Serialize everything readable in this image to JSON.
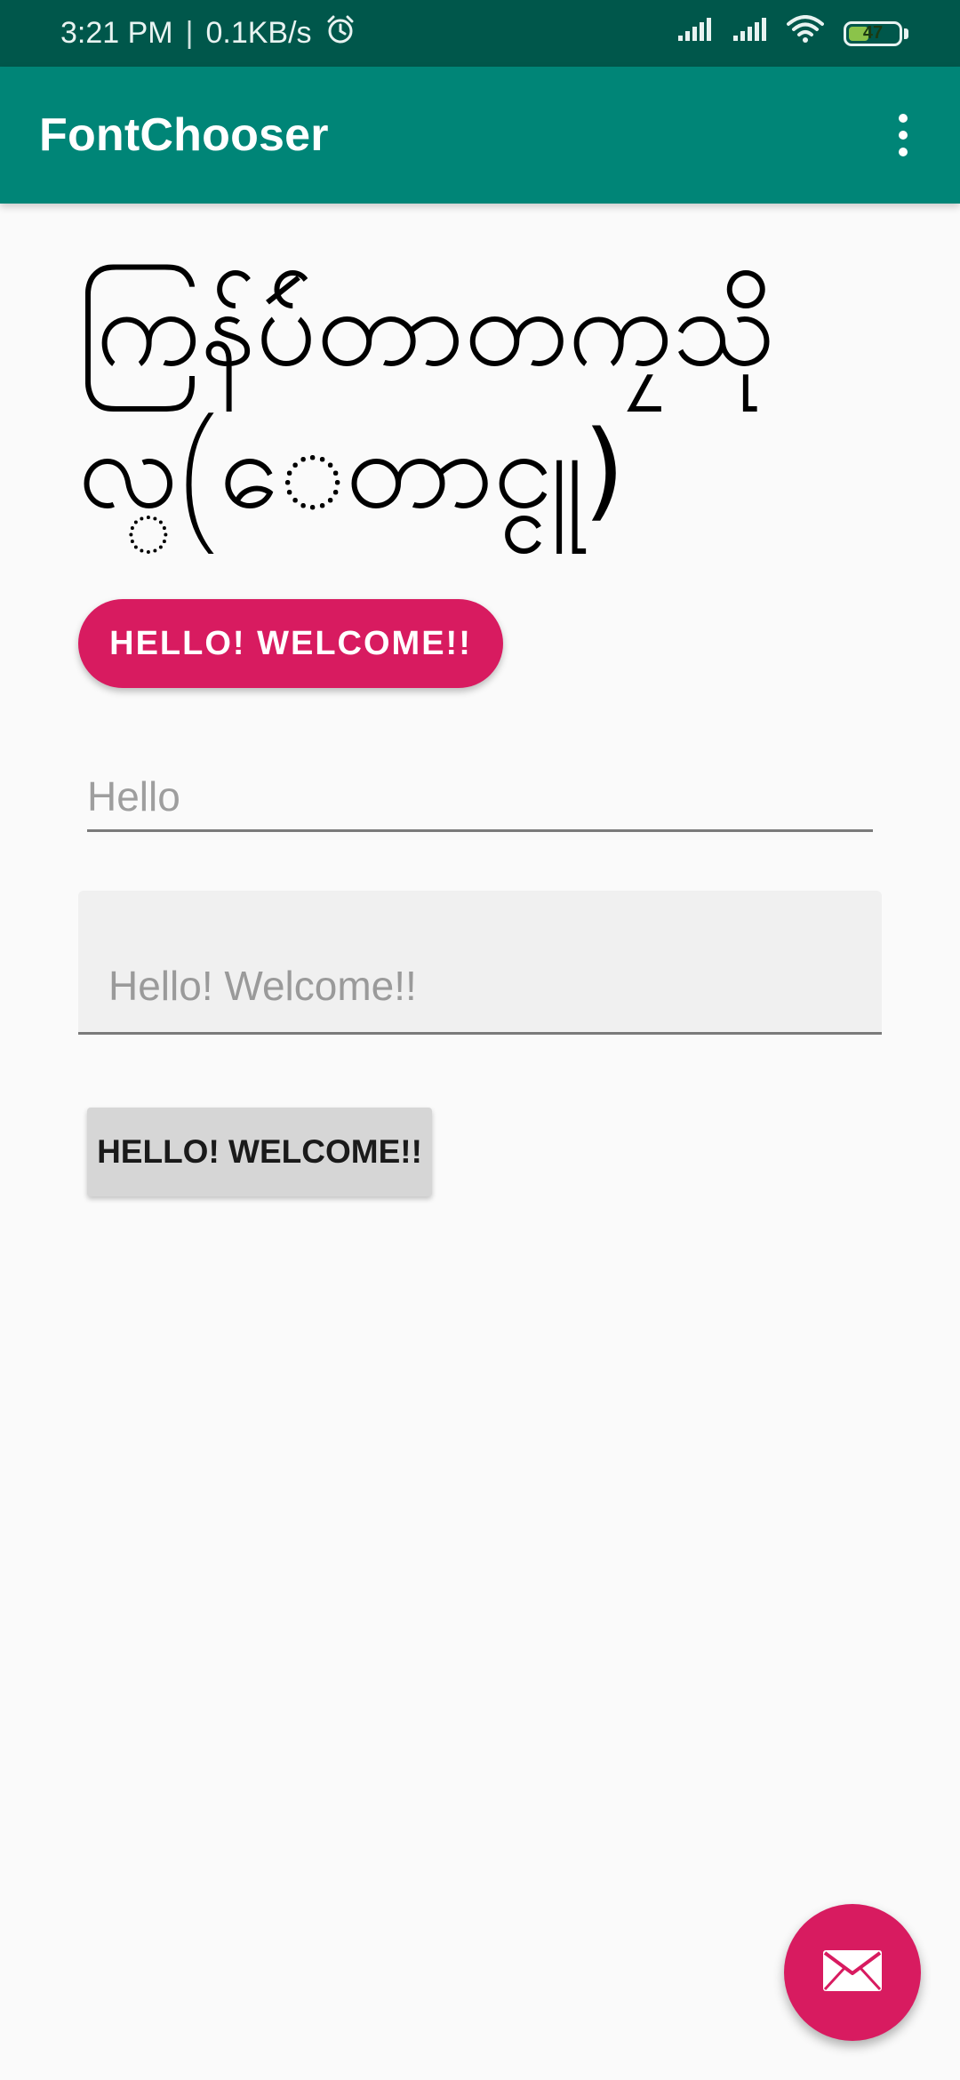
{
  "status_bar": {
    "time": "3:21 PM",
    "separator": "|",
    "net_speed": "0.1KB/s",
    "battery_level": "47",
    "battery_fraction": 0.47,
    "icons": [
      "alarm-icon",
      "signal-icon",
      "signal-icon",
      "wifi-icon",
      "battery-icon"
    ]
  },
  "app_bar": {
    "title": "FontChooser",
    "menu_icon": "overflow-menu-icon"
  },
  "main": {
    "myanmar_text": "ကြန်ပ်ဴတာတကၠသိုလ္(ေတာင္ငူ)",
    "accent_button_label": "HELLO! WELCOME!!",
    "edit_text_hint": "Hello",
    "filled_field_hint": "Hello! Welcome!!",
    "gray_button_label": "HELLO! WELCOME!!"
  },
  "fab": {
    "icon": "email-icon"
  },
  "colors": {
    "status_bar": "#00574b",
    "app_bar": "#008577",
    "accent": "#d81b60",
    "background": "#fafafa"
  }
}
